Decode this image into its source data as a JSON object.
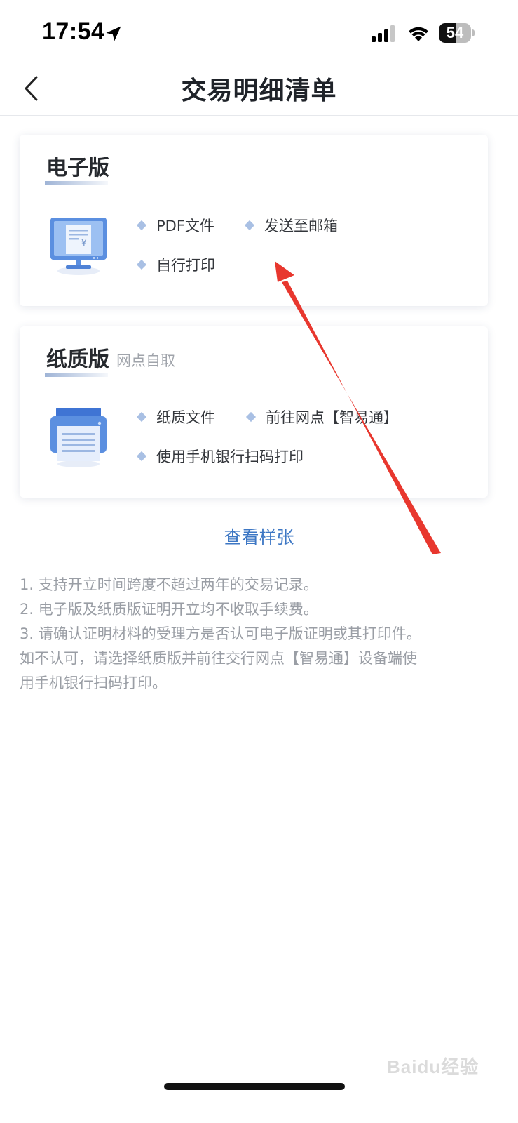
{
  "status_bar": {
    "time": "17:54",
    "battery": "54"
  },
  "nav": {
    "title": "交易明细清单"
  },
  "electronic_card": {
    "title": "电子版",
    "features": [
      "PDF文件",
      "发送至邮箱",
      "自行打印"
    ]
  },
  "paper_card": {
    "title": "纸质版",
    "subtitle": "网点自取",
    "features": [
      "纸质文件",
      "前往网点【智易通】",
      "使用手机银行扫码打印"
    ]
  },
  "sample_link": "查看样张",
  "notes": [
    "1. 支持开立时间跨度不超过两年的交易记录。",
    "2. 电子版及纸质版证明开立均不收取手续费。",
    "3. 请确认证明材料的受理方是否认可电子版证明或其打印件。",
    "如不认可，请选择纸质版并前往交行网点【智易通】设备端使",
    "用手机银行扫码打印。"
  ],
  "watermark": "Baidu经验",
  "colors": {
    "accent_link": "#3d77c4",
    "bullet": "#a9c0e4",
    "annotation": "#e8372e"
  }
}
